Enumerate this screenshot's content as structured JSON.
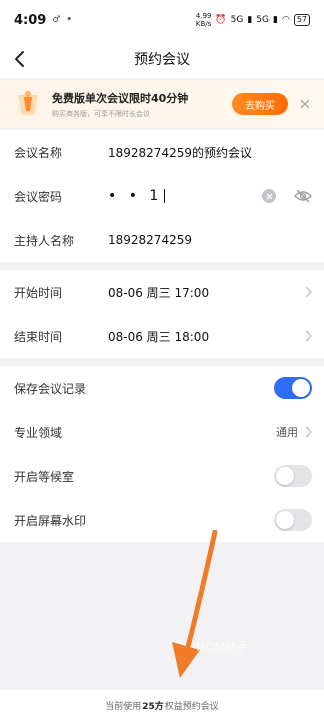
{
  "status": {
    "time": "4:09",
    "net_speed_value": "4.99",
    "net_speed_unit": "KB/s",
    "signal1": "5G",
    "signal2": "5G",
    "battery": "57"
  },
  "nav": {
    "title": "预约会议"
  },
  "promo": {
    "title": "免费版单次会议限时40分钟",
    "subtitle": "购买商务版，可享不限时长会议",
    "button": "去购买"
  },
  "form": {
    "meeting_name_label": "会议名称",
    "meeting_name_value": "18928274259的预约会议",
    "password_label": "会议密码",
    "password_value": "• • 1",
    "host_label": "主持人名称",
    "host_value": "18928274259"
  },
  "schedule": {
    "start_label": "开始时间",
    "start_value": "08-06 周三 17:00",
    "end_label": "结束时间",
    "end_value": "08-06 周三 18:00"
  },
  "settings": {
    "save_record_label": "保存会议记录",
    "save_record_on": true,
    "field_label": "专业领域",
    "field_value": "通用",
    "waiting_room_label": "开启等候室",
    "waiting_room_on": false,
    "watermark_label": "开启屏幕水印",
    "watermark_on": false
  },
  "footer": {
    "prefix": "当前使用",
    "highlight": "25方",
    "suffix": "权益预约会议"
  },
  "overlay_watermark": "HDM助手",
  "colors": {
    "accent": "#2f6df6",
    "orange": "#ff7a0f",
    "arrow": "#f07c2a"
  }
}
